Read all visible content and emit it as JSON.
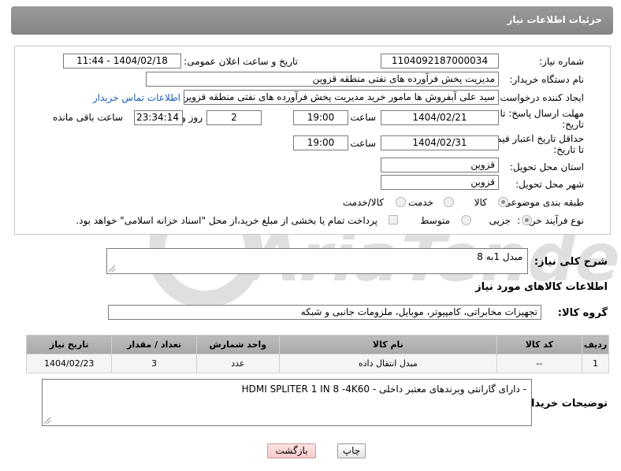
{
  "header": {
    "title": "جزئیات اطلاعات نیاز"
  },
  "form": {
    "need_number_label": "شماره نیاز:",
    "need_number": "1104092187000034",
    "announce_label": "تاریخ و ساعت اعلان عمومی:",
    "announce_value": "1404/02/18 - 11:44",
    "buyer_org_label": "نام دستگاه خریدار:",
    "buyer_org": "مدیریت پخش فرآورده های نفتی منطقه قزوین",
    "creator_label": "ایجاد کننده درخواست:",
    "creator": "سید علی  آبفروش ها مامور خرید مدیریت پخش فرآورده های نفتی منطقه قزوین",
    "contact_link": "اطلاعات تماس خریدار",
    "deadline_label": "مهلت ارسال پاسخ: تا",
    "deadline_label2": "تاریخ:",
    "deadline_date": "1404/02/21",
    "time_label": "ساعت",
    "deadline_time": "19:00",
    "days_value": "2",
    "days_label": "روز و",
    "remaining_time": "23:34:14",
    "remaining_label": "ساعت باقی مانده",
    "validity_label": "حداقل تاریخ اعتبار قیمت:",
    "validity_label2": "تا تاریخ:",
    "validity_date": "1404/02/31",
    "validity_time_label": "ساعت",
    "validity_time": "19:00",
    "province_label": "استان محل تحویل:",
    "province": "قزوین",
    "city_label": "شهر محل تحویل:",
    "city": "قزوین",
    "category_label": "طبقه بندی موضوعی:",
    "category_options": [
      "کالا",
      "خدمت",
      "کالا/خدمت"
    ],
    "process_label": "نوع فرآیند خرید :",
    "process_options": [
      "جزیی",
      "متوسط"
    ],
    "payment_note": "پرداخت تمام یا بخشی از مبلغ خرید،از محل \"اسناد خزانه اسلامی\" خواهد بود."
  },
  "summary": {
    "label": "شرح کلی نیاز:",
    "value": "مبدل 1به 8"
  },
  "goods": {
    "section_title": "اطلاعات کالاهای مورد نیاز",
    "group_label": "گروه کالا:",
    "group_value": "تجهیزات مخابراتی، کامپیوتر، موبایل، ملزومات جانبی و شبکه",
    "columns": [
      "ردیف",
      "کد کالا",
      "نام کالا",
      "واحد شمارش",
      "تعداد / مقدار",
      "تاریخ نیاز"
    ],
    "rows": [
      [
        "1",
        "--",
        "مبدل انتقال داده",
        "عدد",
        "3",
        "1404/02/23"
      ]
    ]
  },
  "buyer_notes": {
    "label": "توضیحات خریدار:",
    "value": "- دارای گارانتی وبرندهای معتبر داخلی  -   HDMI SPLITER 1 IN 8 -4K60"
  },
  "buttons": {
    "print": "چاپ",
    "back": "بازگشت"
  },
  "watermark": "AriaTender.net"
}
